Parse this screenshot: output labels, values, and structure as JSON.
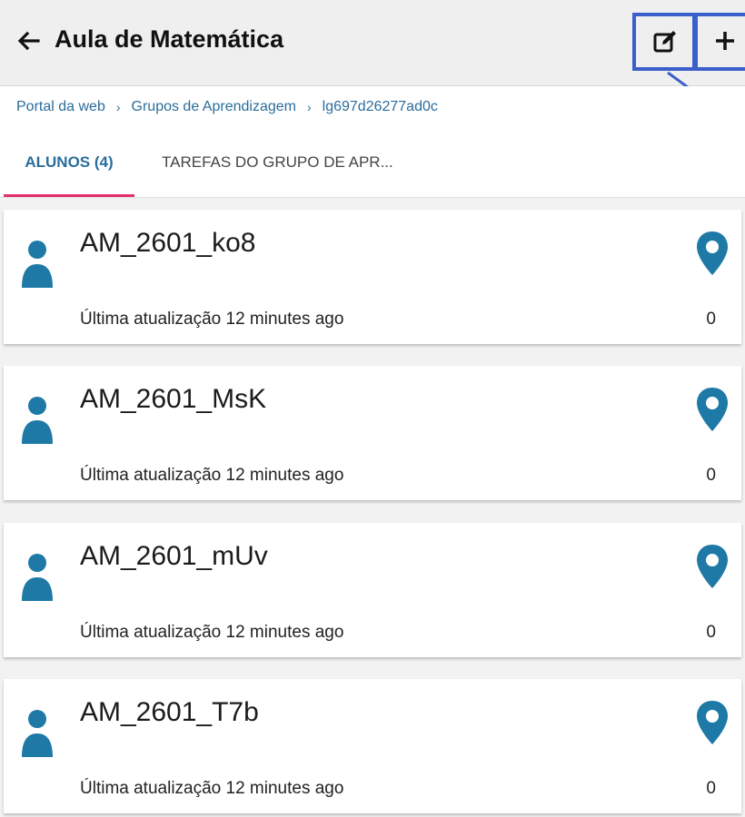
{
  "header": {
    "back_icon": "arrow-left-icon",
    "title": "Aula de Matemática",
    "edit_icon": "edit-icon",
    "add_icon": "plus-icon",
    "highlight_color": "#3a5fcb"
  },
  "breadcrumb": {
    "items": [
      "Portal da web",
      "Grupos de Aprendizagem",
      "lg697d26277ad0c"
    ],
    "separator": "›",
    "color": "#2a6d9b"
  },
  "tabs": [
    {
      "label": "ALUNOS (4)",
      "active": true
    },
    {
      "label": "TAREFAS DO GRUPO DE APR...",
      "active": false
    }
  ],
  "tab_indicator_color": "#e3306a",
  "students": [
    {
      "name": "AM_2601_ko8",
      "updated": "Última atualização 12 minutes ago",
      "count": "0"
    },
    {
      "name": "AM_2601_MsK",
      "updated": "Última atualização 12 minutes ago",
      "count": "0"
    },
    {
      "name": "AM_2601_mUv",
      "updated": "Última atualização 12 minutes ago",
      "count": "0"
    },
    {
      "name": "AM_2601_T7b",
      "updated": "Última atualização 12 minutes ago",
      "count": "0"
    }
  ],
  "icons": {
    "avatar": "user-avatar-icon",
    "location": "location-pin-icon",
    "accent_color": "#1e79a6"
  }
}
